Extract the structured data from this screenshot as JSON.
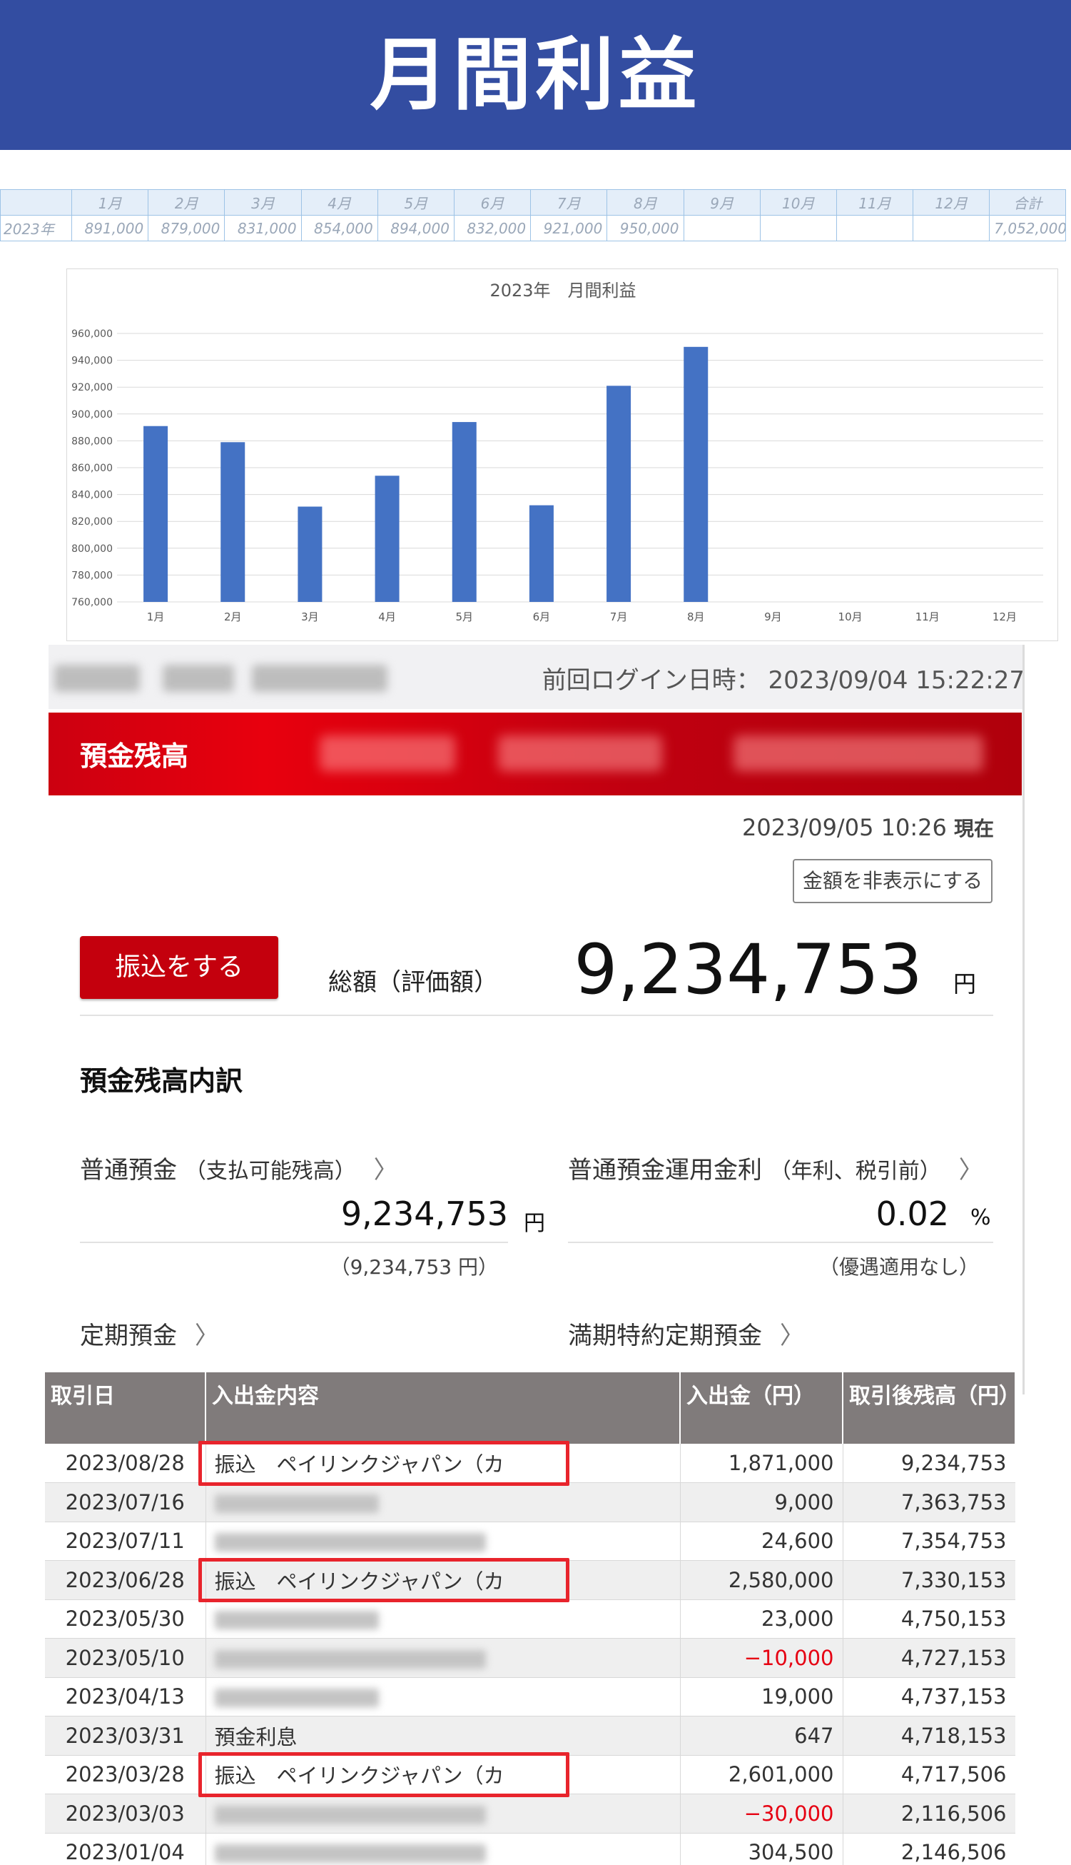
{
  "banner": {
    "title": "月間利益"
  },
  "monthly_table": {
    "headers": [
      "1月",
      "2月",
      "3月",
      "4月",
      "5月",
      "6月",
      "7月",
      "8月",
      "9月",
      "10月",
      "11月",
      "12月",
      "合計"
    ],
    "row_label": "2023年",
    "values": [
      "891,000",
      "879,000",
      "831,000",
      "854,000",
      "894,000",
      "832,000",
      "921,000",
      "950,000",
      "",
      "",
      "",
      "",
      "7,052,000"
    ]
  },
  "chart_data": {
    "type": "bar",
    "title": "2023年　月間利益",
    "categories": [
      "1月",
      "2月",
      "3月",
      "4月",
      "5月",
      "6月",
      "7月",
      "8月",
      "9月",
      "10月",
      "11月",
      "12月"
    ],
    "values": [
      891000,
      879000,
      831000,
      854000,
      894000,
      832000,
      921000,
      950000,
      null,
      null,
      null,
      null
    ],
    "ylim": [
      760000,
      960000
    ],
    "yticks": [
      760000,
      780000,
      800000,
      820000,
      840000,
      860000,
      880000,
      900000,
      920000,
      940000,
      960000
    ],
    "ytick_labels": [
      "760,000",
      "780,000",
      "800,000",
      "820,000",
      "840,000",
      "860,000",
      "880,000",
      "900,000",
      "920,000",
      "940,000",
      "960,000"
    ],
    "bar_color": "#4472c4",
    "grid": true,
    "xlabel": "",
    "ylabel": ""
  },
  "bank": {
    "last_login": "前回ログイン日時： 2023/09/04 15:22:27",
    "section_title": "預金残高",
    "as_of_date": "2023/09/05 10:26",
    "as_of_suffix": "現在",
    "hide_amount_label": "金額を非表示にする",
    "transfer_label": "振込をする",
    "total_label": "総額（評価額）",
    "total_value": "9,234,753",
    "yen": "円",
    "breakdown_title": "預金残高内訳",
    "ordinary": {
      "label": "普通預金",
      "sub": "（支払可能残高）",
      "value": "9,234,753",
      "unit": "円",
      "note": "（9,234,753 円）"
    },
    "interest": {
      "label": "普通預金運用金利",
      "sub": "（年利、税引前）",
      "value": "0.02",
      "unit": "%",
      "note": "（優遇適用なし）"
    },
    "time_deposit": {
      "label": "定期預金"
    },
    "special_deposit": {
      "label": "満期特約定期預金"
    },
    "chevron": "〉",
    "accent_color": "#c4000d"
  },
  "transactions": {
    "headers": [
      "取引日",
      "入出金内容",
      "入出金（円）",
      "取引後残高（円）"
    ],
    "rows": [
      {
        "date": "2023/08/28",
        "desc": "振込　ペイリンクジャパン（カ",
        "amount": "1,871,000",
        "balance": "9,234,753",
        "neg": false,
        "blur": false
      },
      {
        "date": "2023/07/16",
        "desc": "",
        "amount": "9,000",
        "balance": "7,363,753",
        "neg": false,
        "blur": true
      },
      {
        "date": "2023/07/11",
        "desc": "",
        "amount": "24,600",
        "balance": "7,354,753",
        "neg": false,
        "blur": true
      },
      {
        "date": "2023/06/28",
        "desc": "振込　ペイリンクジャパン（カ",
        "amount": "2,580,000",
        "balance": "7,330,153",
        "neg": false,
        "blur": false
      },
      {
        "date": "2023/05/30",
        "desc": "",
        "amount": "23,000",
        "balance": "4,750,153",
        "neg": false,
        "blur": true
      },
      {
        "date": "2023/05/10",
        "desc": "",
        "amount": "−10,000",
        "balance": "4,727,153",
        "neg": true,
        "blur": true
      },
      {
        "date": "2023/04/13",
        "desc": "",
        "amount": "19,000",
        "balance": "4,737,153",
        "neg": false,
        "blur": true
      },
      {
        "date": "2023/03/31",
        "desc": "預金利息",
        "amount": "647",
        "balance": "4,718,153",
        "neg": false,
        "blur": false
      },
      {
        "date": "2023/03/28",
        "desc": "振込　ペイリンクジャパン（カ",
        "amount": "2,601,000",
        "balance": "4,717,506",
        "neg": false,
        "blur": false
      },
      {
        "date": "2023/03/03",
        "desc": "",
        "amount": "−30,000",
        "balance": "2,116,506",
        "neg": true,
        "blur": true
      },
      {
        "date": "2023/01/04",
        "desc": "",
        "amount": "304,500",
        "balance": "2,146,506",
        "neg": false,
        "blur": true
      }
    ],
    "highlight_color": "#e8242c"
  }
}
